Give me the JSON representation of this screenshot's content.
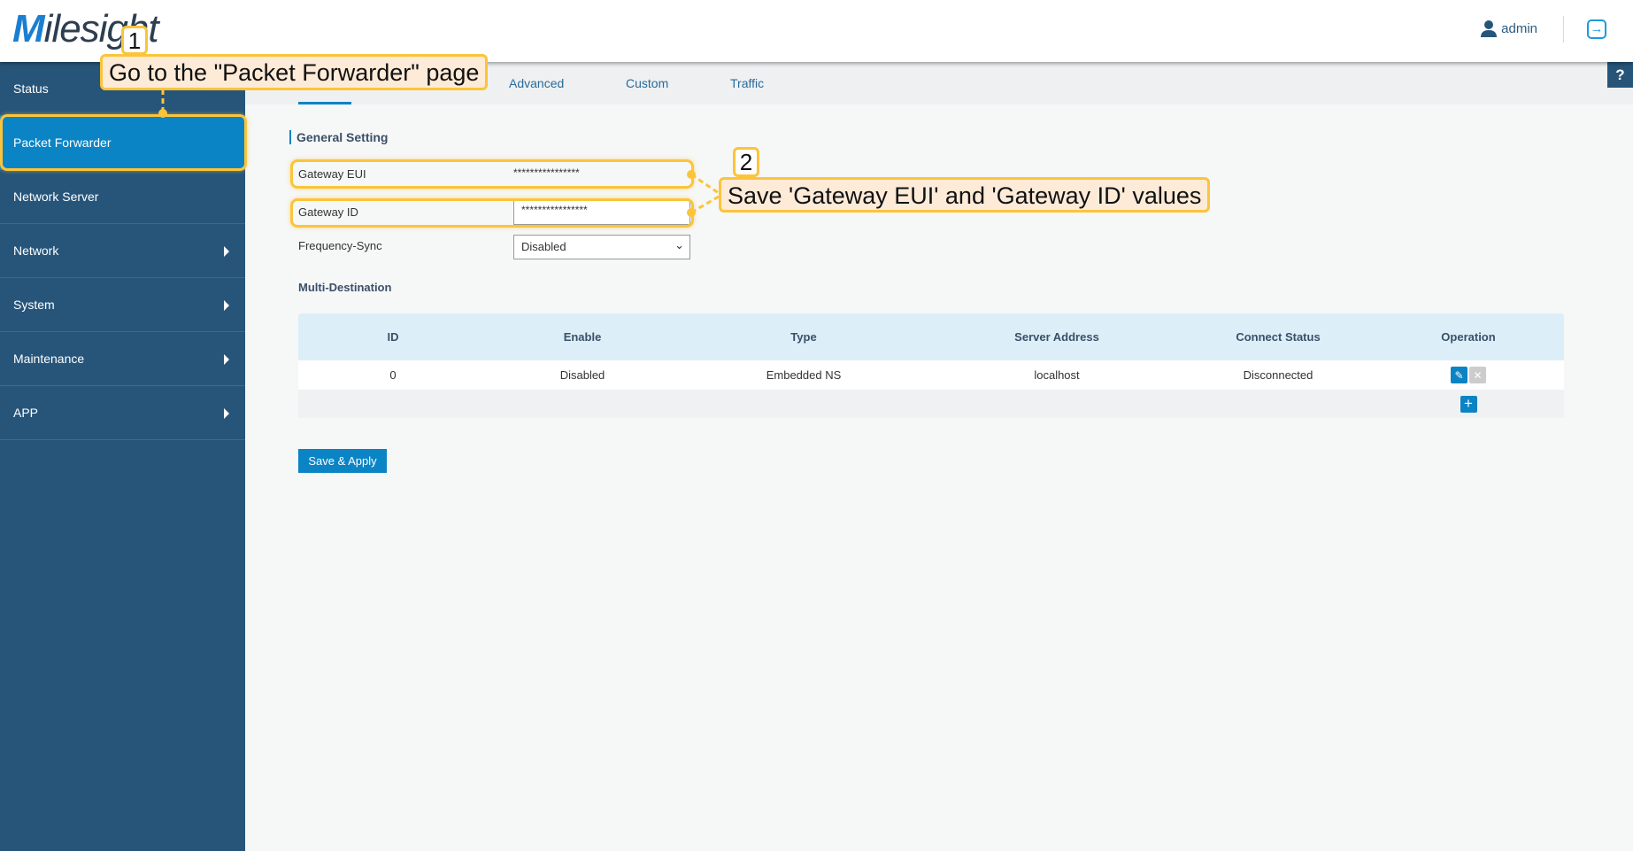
{
  "header": {
    "logo": "Milesight",
    "user": "admin"
  },
  "sidebar": {
    "items": [
      {
        "label": "Status",
        "submenu": false
      },
      {
        "label": "Packet Forwarder",
        "submenu": false,
        "active": true
      },
      {
        "label": "Network Server",
        "submenu": false
      },
      {
        "label": "Network",
        "submenu": true
      },
      {
        "label": "System",
        "submenu": true
      },
      {
        "label": "Maintenance",
        "submenu": true
      },
      {
        "label": "APP",
        "submenu": true
      }
    ]
  },
  "tabs": {
    "items": [
      "Advanced",
      "Custom",
      "Traffic"
    ]
  },
  "help": "?",
  "general": {
    "title": "General Setting",
    "gateway_eui_label": "Gateway EUI",
    "gateway_eui_value": "****************",
    "gateway_id_label": "Gateway ID",
    "gateway_id_value": "****************",
    "frequency_sync_label": "Frequency-Sync",
    "frequency_sync_value": "Disabled"
  },
  "multi": {
    "title": "Multi-Destination",
    "headers": [
      "ID",
      "Enable",
      "Type",
      "Server Address",
      "Connect Status",
      "Operation"
    ],
    "rows": [
      [
        "0",
        "Disabled",
        "Embedded NS",
        "localhost",
        "Disconnected"
      ]
    ]
  },
  "save_label": "Save & Apply",
  "annotations": {
    "step1_num": "1",
    "step1_text": "Go to the \"Packet Forwarder\" page",
    "step2_num": "2",
    "step2_text": "Save 'Gateway EUI' and 'Gateway ID' values"
  },
  "colors": {
    "sidebar": "#27557a",
    "accent": "#0a84c4",
    "highlight": "#fbc43a"
  }
}
